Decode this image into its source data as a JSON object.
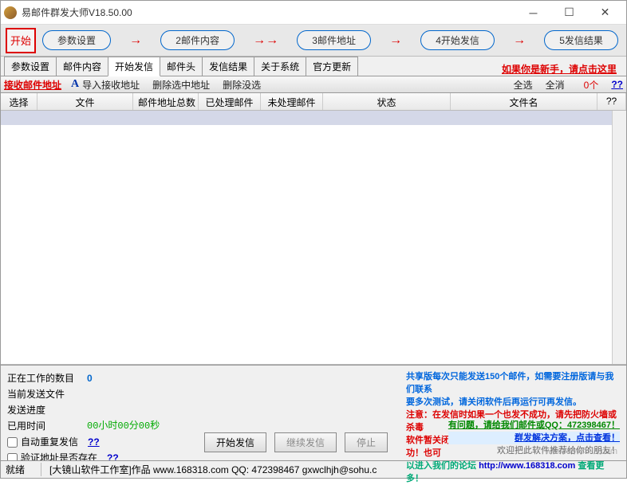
{
  "window": {
    "title": "易邮件群发大师V18.50.00"
  },
  "steps": {
    "start": "开始",
    "s1": "参数设置",
    "s2": "2邮件内容",
    "s3": "3邮件地址",
    "s4": "4开始发信",
    "s5": "5发信结果"
  },
  "tabs": [
    "参数设置",
    "邮件内容",
    "开始发信",
    "邮件头",
    "发信结果",
    "关于系统",
    "官方更新"
  ],
  "newbie_link": "如果你是新手，请点击这里",
  "toolbar": {
    "title": "接收邮件地址",
    "bold_a": "A",
    "import": "导入接收地址",
    "del_sel": "删除选中地址",
    "del_unsel": "删除没选",
    "sel_all": "全选",
    "sel_none": "全消",
    "count": "0个",
    "qq": "??"
  },
  "columns": [
    "选择",
    "文件",
    "邮件地址总数",
    "已处理邮件",
    "未处理邮件",
    "状态",
    "文件名",
    "??"
  ],
  "status_left": {
    "working_lbl": "正在工作的数目",
    "working_val": "0",
    "curfile_lbl": "当前发送文件",
    "progress_lbl": "发送进度",
    "elapsed_lbl": "已用时间",
    "elapsed_val": "00小时00分00秒",
    "cb_auto": "自动重复发信",
    "cb_verify": "验证地址是否存在",
    "qq": "??"
  },
  "buttons": {
    "start": "开始发信",
    "continue": "继续发信",
    "stop": "停止"
  },
  "notice": {
    "l1": "共享版每次只能发送150个邮件，如需要注册版请与我们联系",
    "l1b": "要多次测试，请关闭软件后再运行可再发信。",
    "l2": "注意：在发信时如果一个也发不成功，请先把防火墙或杀毒",
    "l2b": "软件暂关闭，这些软件可能会挡信导致一个也发不成功！也可",
    "l3a": "以进入我们的论坛 ",
    "l3link": "http://www.168318.com",
    "l3b": " 查看更多！",
    "bl1": "有问题，请给我们邮件或QQ：472398467！",
    "bl2": "群发解决方案，点击查看！",
    "bl3": "欢迎把此软件推荐给你的朋友！"
  },
  "statusbar": {
    "ready": "就绪",
    "credit": "[大镜山软件工作室]作品 www.168318.com QQ: 472398467  gxwclhjh@sohu.c"
  },
  "watermark": "www.downxia.com"
}
